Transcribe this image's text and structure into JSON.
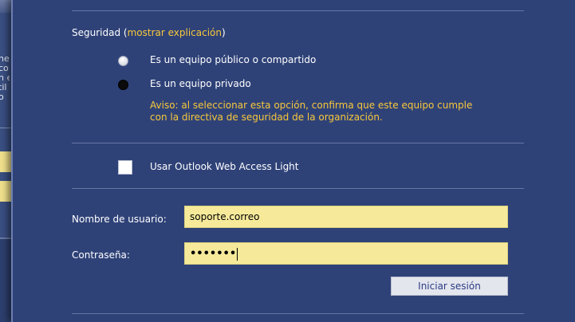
{
  "background_window": {
    "text_lines": [
      "ne",
      "co",
      "n e",
      "til",
      "o"
    ]
  },
  "security": {
    "label": "Seguridad (",
    "link": "mostrar explicación",
    "close": ")",
    "options": [
      {
        "label": "Es un equipo público o compartido",
        "selected": false
      },
      {
        "label": "Es un equipo privado",
        "selected": true
      }
    ],
    "warning_line1": "Aviso: al seleccionar esta opción, confirma que este equipo cumple",
    "warning_line2": "con la directiva de seguridad de la organización."
  },
  "light": {
    "label": "Usar Outlook Web Access Light",
    "checked": false
  },
  "login": {
    "username_label": "Nombre de usuario:",
    "username_value": "soporte.correo",
    "password_label": "Contraseña:",
    "password_mask": "•••••••",
    "submit_label": "Iniciar sesión"
  },
  "colors": {
    "panel": "#2f4278",
    "link": "#f7c83b",
    "input_bg": "#f6ea9a"
  }
}
